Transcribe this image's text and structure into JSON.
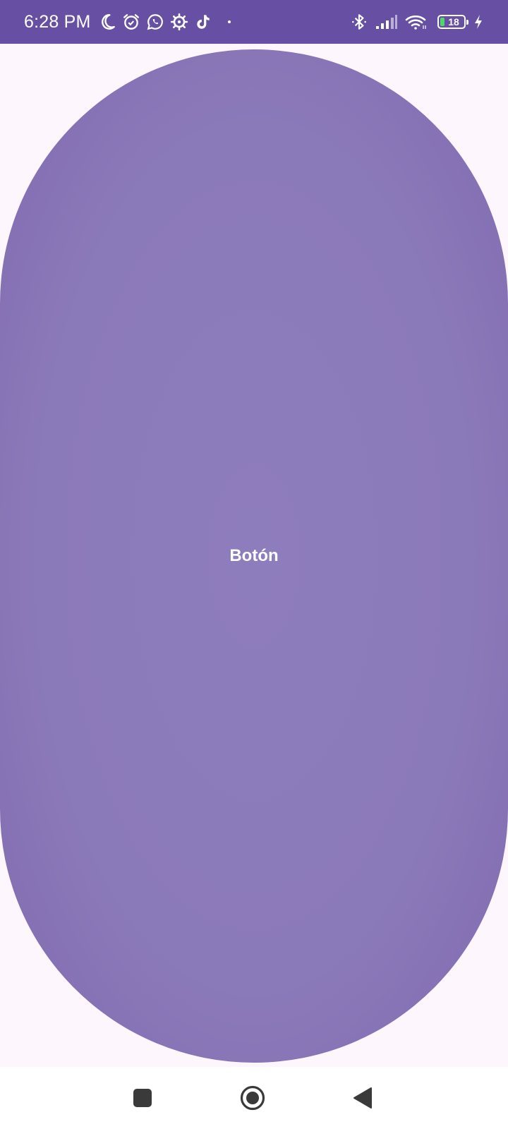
{
  "status_bar": {
    "time": "6:28 PM",
    "battery_level": "18",
    "icons_left": [
      "moon-icon",
      "alarm-icon",
      "whatsapp-icon",
      "settings-gear-icon",
      "tiktok-icon"
    ],
    "icons_right": [
      "bluetooth-icon",
      "signal-icon",
      "wifi-icon",
      "battery-icon",
      "charging-icon"
    ],
    "colors": {
      "background": "#6750a4",
      "battery_fill": "#4cd964"
    }
  },
  "main": {
    "button_label": "Botón",
    "button_color": "#8b7aba",
    "page_background": "#fdf7fd"
  },
  "nav_bar": {
    "buttons": [
      "recents-icon",
      "home-icon",
      "back-icon"
    ]
  }
}
